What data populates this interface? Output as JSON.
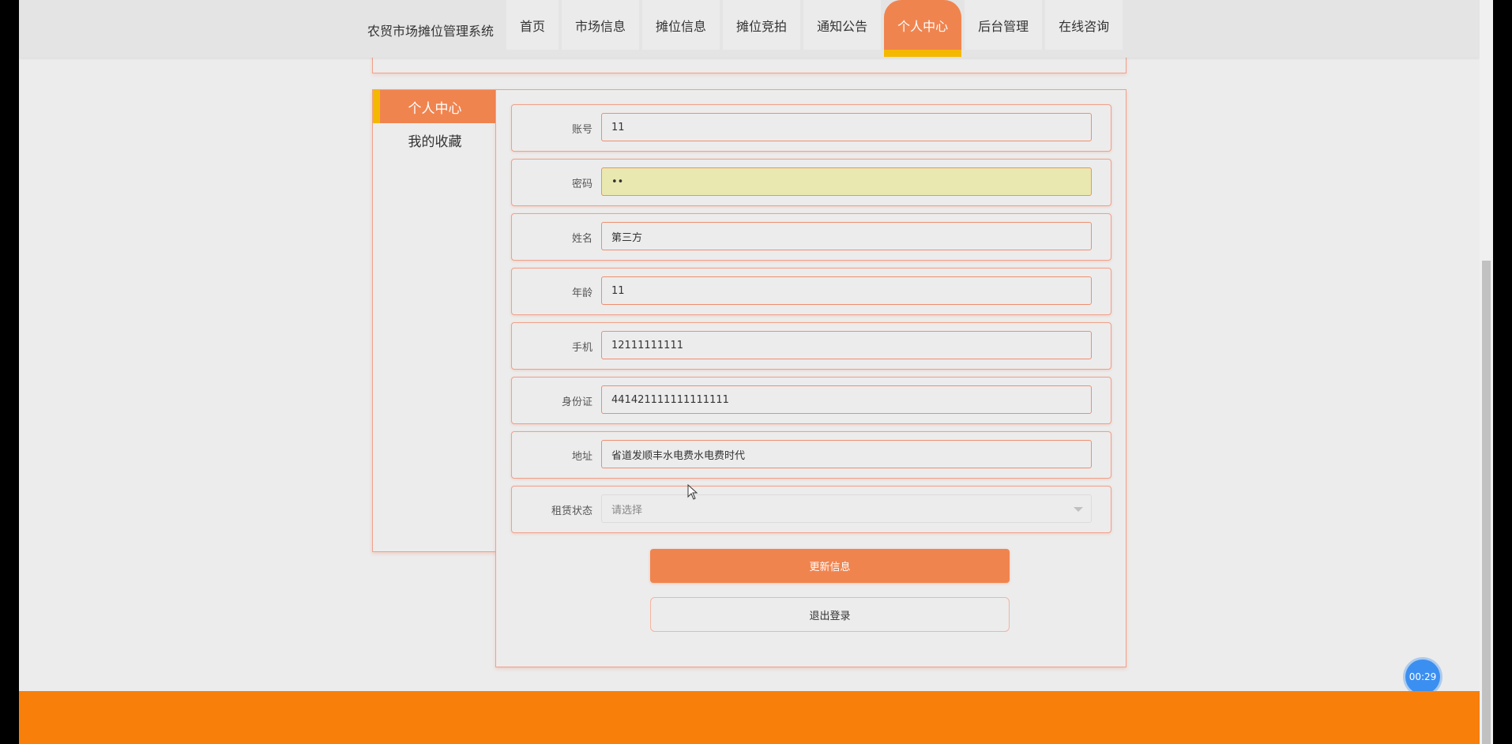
{
  "header": {
    "brand": "农贸市场摊位管理系统",
    "nav": [
      {
        "label": "首页"
      },
      {
        "label": "市场信息"
      },
      {
        "label": "摊位信息"
      },
      {
        "label": "摊位竞拍"
      },
      {
        "label": "通知公告"
      },
      {
        "label": "个人中心"
      },
      {
        "label": "后台管理"
      },
      {
        "label": "在线咨询"
      }
    ],
    "active_nav": "个人中心"
  },
  "sidebar": {
    "items": [
      {
        "label": "个人中心"
      },
      {
        "label": "我的收藏"
      }
    ]
  },
  "form": {
    "fields": [
      {
        "label": "账号",
        "value": "11"
      },
      {
        "label": "密码",
        "value": "11"
      },
      {
        "label": "姓名",
        "value": "第三方"
      },
      {
        "label": "年龄",
        "value": "11"
      },
      {
        "label": "手机",
        "value": "12111111111"
      },
      {
        "label": "身份证",
        "value": "441421111111111111"
      },
      {
        "label": "地址",
        "value": "省道发顺丰水电费水电费时代"
      }
    ],
    "rental_status": {
      "label": "租赁状态",
      "placeholder": "请选择"
    },
    "update_button": "更新信息",
    "logout_button": "退出登录"
  },
  "timer": "00:29",
  "colors": {
    "accent": "#f0844f",
    "accent_yellow": "#f5b800",
    "footer": "#f97f0b",
    "timer": "#3b8ff0"
  }
}
